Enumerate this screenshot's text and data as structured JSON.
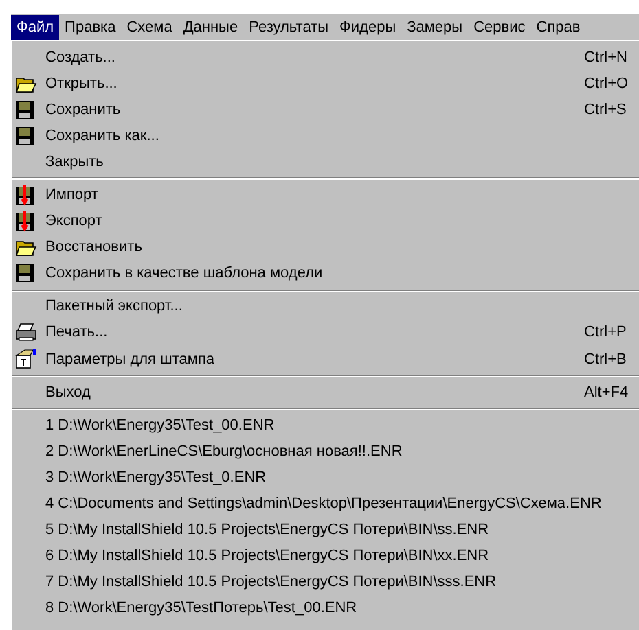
{
  "menu_bar": [
    {
      "label": "Файл",
      "selected": true
    },
    {
      "label": "Правка",
      "selected": false
    },
    {
      "label": "Схема",
      "selected": false
    },
    {
      "label": "Данные",
      "selected": false
    },
    {
      "label": "Результаты",
      "selected": false
    },
    {
      "label": "Фидеры",
      "selected": false
    },
    {
      "label": "Замеры",
      "selected": false
    },
    {
      "label": "Сервис",
      "selected": false
    },
    {
      "label": "Справ",
      "selected": false
    }
  ],
  "file_menu": {
    "sections": [
      {
        "items": [
          {
            "label": "Создать...",
            "shortcut": "Ctrl+N"
          },
          {
            "label": "Открыть...",
            "shortcut": "Ctrl+O",
            "kind": "folder"
          },
          {
            "label": "Сохранить",
            "shortcut": "Ctrl+S",
            "kind": "floppy"
          },
          {
            "label": "Сохранить как...",
            "kind": "floppy"
          },
          {
            "label": "Закрыть"
          }
        ]
      },
      {
        "items": [
          {
            "label": "Импорт",
            "kind": "transfer"
          },
          {
            "label": "Экспорт",
            "kind": "transfer"
          },
          {
            "label": "Восстановить",
            "kind": "folder"
          },
          {
            "label": "Сохранить в качестве шаблона модели",
            "kind": "floppy"
          }
        ]
      },
      {
        "items": [
          {
            "label": "Пакетный экспорт..."
          },
          {
            "label": "Печать...",
            "shortcut": "Ctrl+P",
            "kind": "printer"
          },
          {
            "label": "Параметры для штампа",
            "shortcut": "Ctrl+B",
            "kind": "stamp"
          }
        ]
      },
      {
        "items": [
          {
            "label": "Выход",
            "shortcut": "Alt+F4"
          }
        ]
      },
      {
        "items": [
          {
            "label": "1 D:\\Work\\Energy35\\Test_00.ENR"
          },
          {
            "label": "2 D:\\Work\\EnerLineCS\\Eburg\\основная новая!!.ENR"
          },
          {
            "label": "3 D:\\Work\\Energy35\\Test_0.ENR"
          },
          {
            "label": "4 C:\\Documents and Settings\\admin\\Desktop\\Презентации\\EnergyCS\\Схема.ENR"
          },
          {
            "label": "5 D:\\My InstallShield 10.5 Projects\\EnergyCS Потери\\BIN\\ss.ENR"
          },
          {
            "label": "6 D:\\My InstallShield 10.5 Projects\\EnergyCS Потери\\BIN\\xx.ENR"
          },
          {
            "label": "7 D:\\My InstallShield 10.5 Projects\\EnergyCS Потери\\BIN\\sss.ENR"
          },
          {
            "label": "8 D:\\Work\\Energy35\\TestПотерь\\Test_00.ENR"
          }
        ]
      }
    ]
  }
}
